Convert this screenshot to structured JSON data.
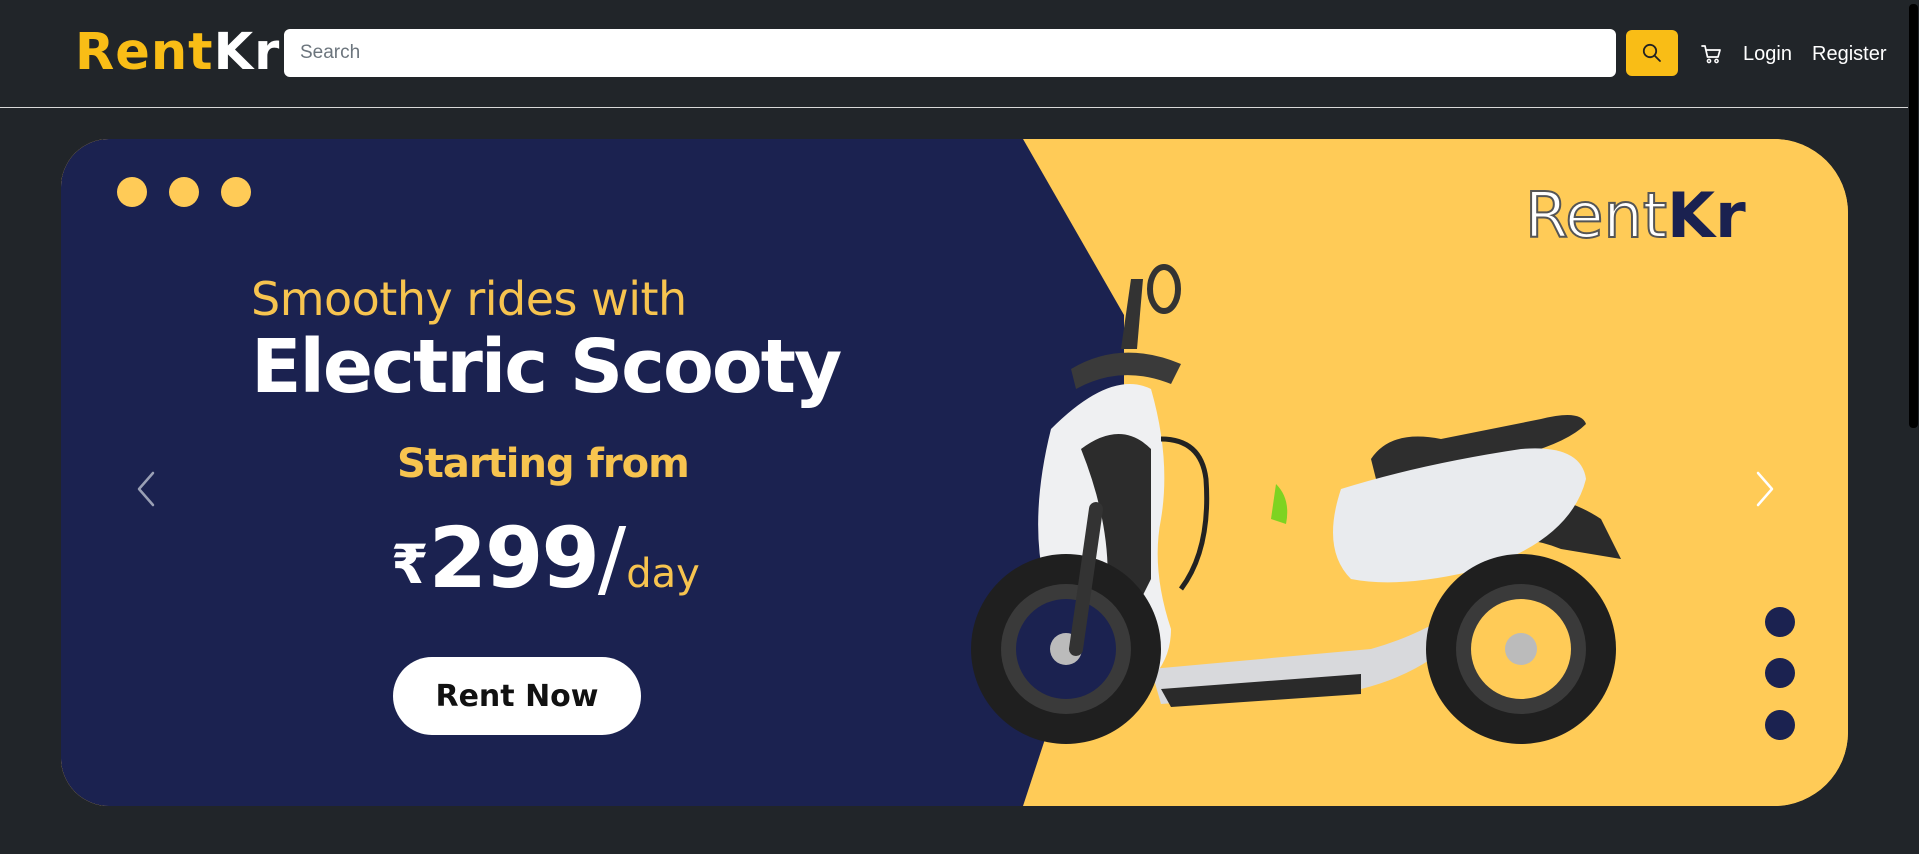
{
  "header": {
    "brand_part1": "Rent",
    "brand_part2": "Kr",
    "search_placeholder": "Search",
    "search_icon": "search-icon",
    "cart_icon": "cart-icon",
    "login_label": "Login",
    "register_label": "Register"
  },
  "banner": {
    "headline_small": "Smoothy rides with",
    "headline_big": "Electric Scooty",
    "starting_label": "Starting from",
    "currency_symbol": "₹",
    "price": "299",
    "price_slash": "/",
    "price_unit": "day",
    "cta_label": "Rent Now",
    "logo_part1": "Rent",
    "logo_part2": "Kr",
    "prev_icon": "chevron-left-icon",
    "next_icon": "chevron-right-icon"
  },
  "colors": {
    "background": "#212529",
    "accent": "#f9bd16",
    "banner_navy": "#1b2250",
    "banner_yellow": "#ffcb57"
  }
}
